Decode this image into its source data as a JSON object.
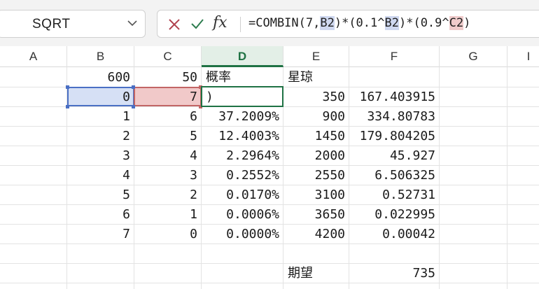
{
  "formula_bar": {
    "name_box": "SQRT",
    "formula_start": "=COMBIN(7,",
    "ref_b": "B2",
    "mid1": ")*(0.1^",
    "ref_b2": "B2",
    "mid2": ")*(0.9^",
    "ref_c": "C2",
    "end": ")",
    "fx_label": "fx"
  },
  "columns": [
    "A",
    "B",
    "C",
    "D",
    "E",
    "F",
    "G",
    "I"
  ],
  "rows": [
    {
      "B": "600",
      "C": "50",
      "D": "概率",
      "E": "星琼",
      "F": ""
    },
    {
      "B": "0",
      "C": "7",
      "D": ")",
      "E": "350",
      "F": "167.403915"
    },
    {
      "B": "1",
      "C": "6",
      "D": "37.2009%",
      "E": "900",
      "F": "334.80783"
    },
    {
      "B": "2",
      "C": "5",
      "D": "12.4003%",
      "E": "1450",
      "F": "179.804205"
    },
    {
      "B": "3",
      "C": "4",
      "D": "2.2964%",
      "E": "2000",
      "F": "45.927"
    },
    {
      "B": "4",
      "C": "3",
      "D": "0.2552%",
      "E": "2550",
      "F": "6.506325"
    },
    {
      "B": "5",
      "C": "2",
      "D": "0.0170%",
      "E": "3100",
      "F": "0.52731"
    },
    {
      "B": "6",
      "C": "1",
      "D": "0.0006%",
      "E": "3650",
      "F": "0.022995"
    },
    {
      "B": "7",
      "C": "0",
      "D": "0.0000%",
      "E": "4200",
      "F": "0.00042"
    },
    {
      "B": "",
      "C": "",
      "D": "",
      "E": "",
      "F": ""
    },
    {
      "B": "",
      "C": "",
      "D": "",
      "E": "期望",
      "F": "735"
    }
  ],
  "colors": {
    "accent_green": "#1f7244",
    "ref_blue": "#4a6fc4",
    "ref_red": "#c26565"
  }
}
